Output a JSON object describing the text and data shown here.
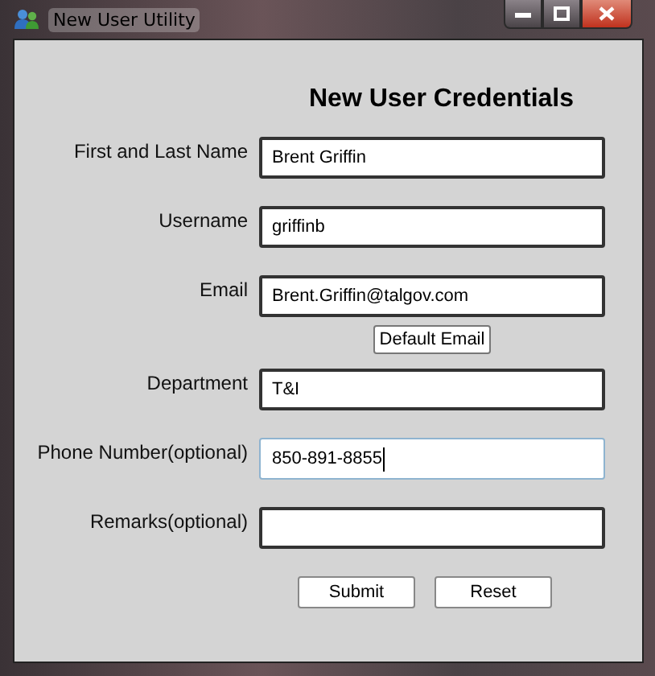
{
  "window": {
    "title": "New User Utility"
  },
  "heading": "New User Credentials",
  "fields": [
    {
      "label": "First and Last Name",
      "value": "Brent Griffin",
      "focused": false
    },
    {
      "label": "Username",
      "value": "griffinb",
      "focused": false
    },
    {
      "label": "Email",
      "value": "Brent.Griffin@talgov.com",
      "focused": false,
      "action": "Default Email"
    },
    {
      "label": "Department",
      "value": "T&I",
      "focused": false
    },
    {
      "label": "Phone Number(optional)",
      "value": "850-891-8855",
      "focused": true
    },
    {
      "label": "Remarks(optional)",
      "focused": false
    }
  ],
  "buttons": [
    "Submit",
    "Reset"
  ]
}
